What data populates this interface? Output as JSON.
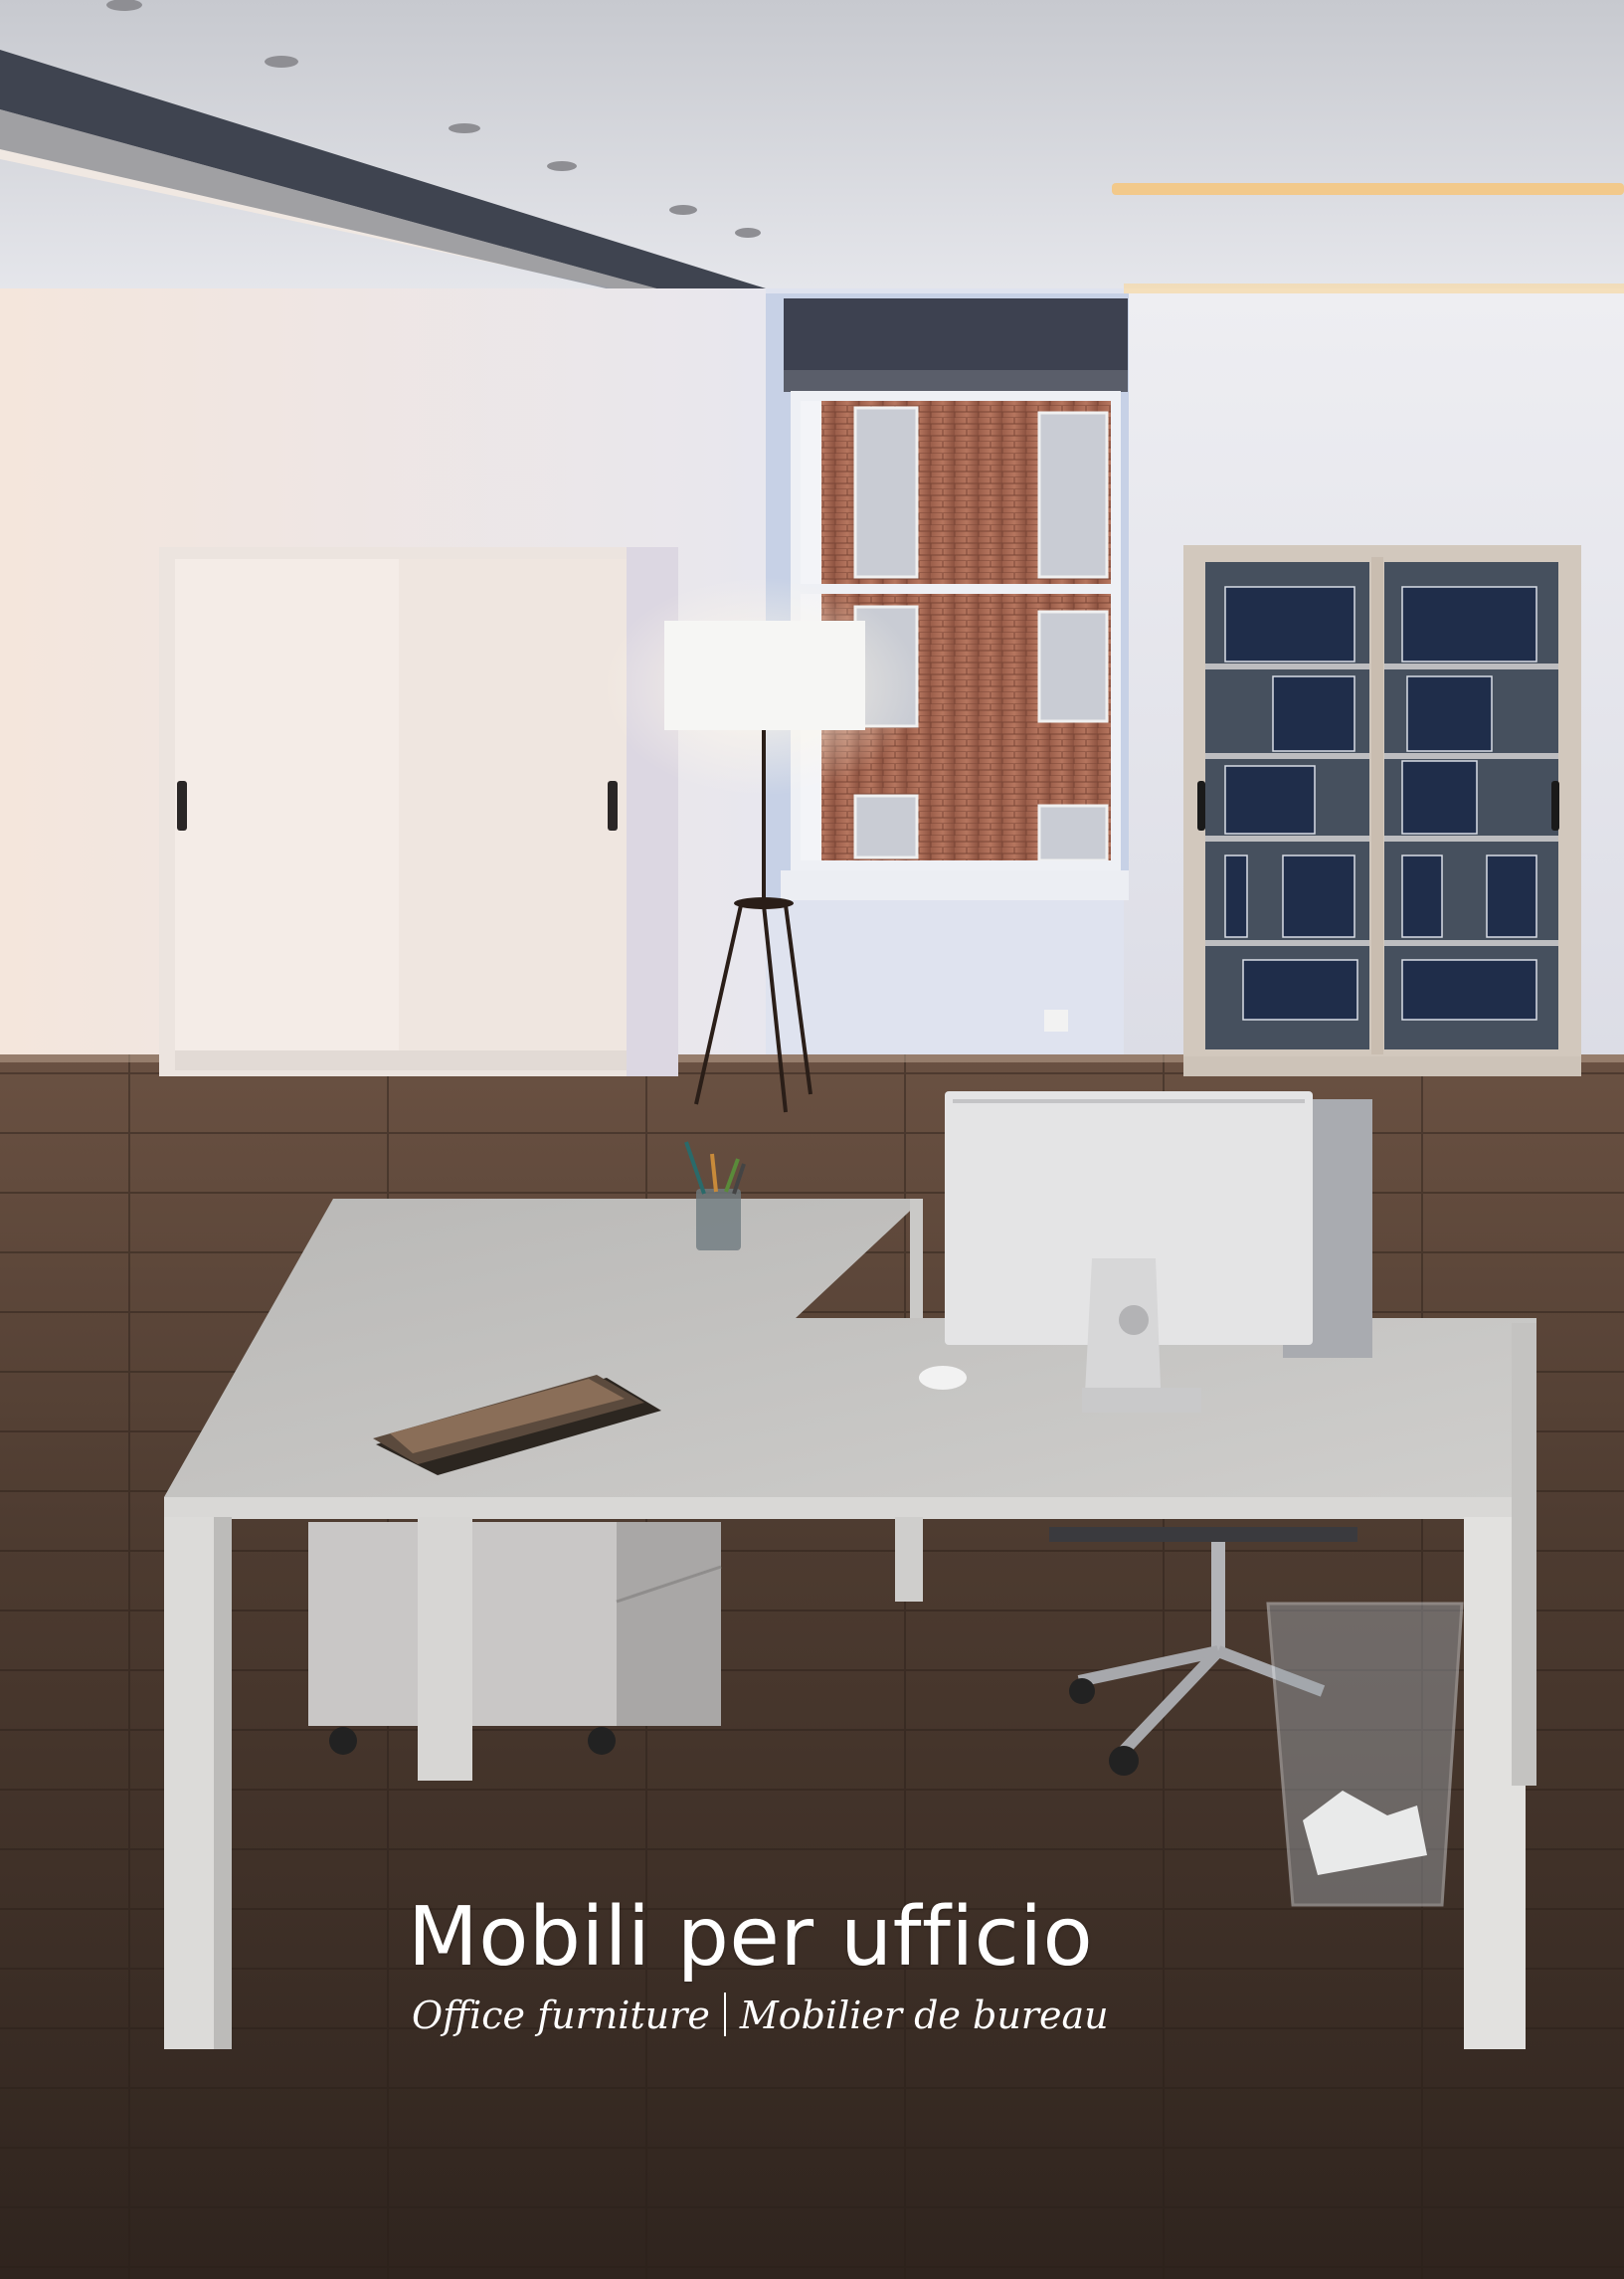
{
  "cover": {
    "title": "Mobili per ufficio",
    "subtitle_en": "Office furniture",
    "subtitle_fr": "Mobilier de bureau"
  },
  "colors": {
    "floor": "#4a382d",
    "wall": "#e4e6ee",
    "desk": "#c9c8c6",
    "binder": "#1f2d4a",
    "caption_text": "#ffffff"
  },
  "scene_elements": [
    "ceiling-with-spotlights",
    "ceiling-beam",
    "window-with-brick-view",
    "sliding-door-cabinet",
    "glass-door-bookcase",
    "floor-lamp",
    "l-shaped-desk",
    "monitor",
    "mouse",
    "pen-cup",
    "magazines",
    "drawer-pedestal",
    "office-chair",
    "wastebasket",
    "wood-floor"
  ]
}
